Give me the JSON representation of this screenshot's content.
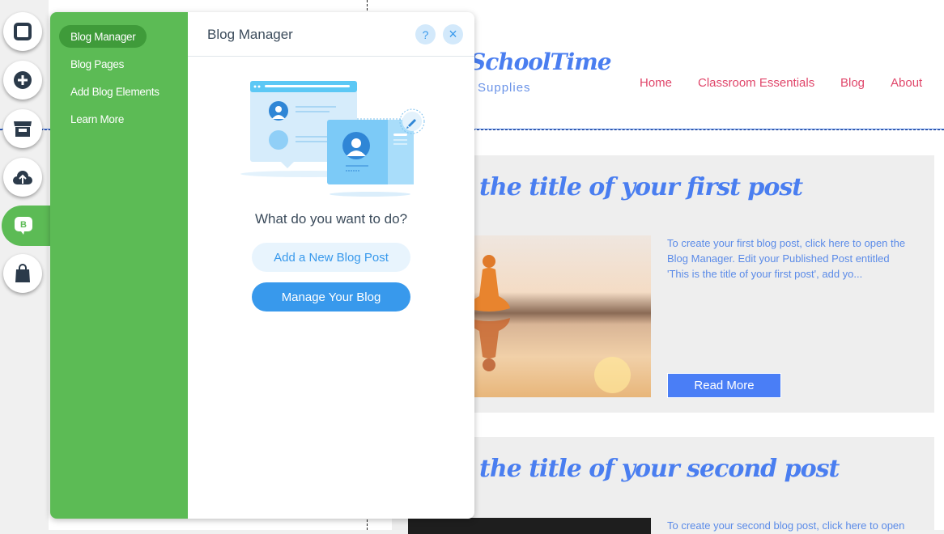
{
  "site": {
    "logo_title": "SchoolTime",
    "logo_subtitle": "Supplies",
    "nav": [
      "Home",
      "Classroom Essentials",
      "Blog",
      "About"
    ],
    "colors": {
      "accent_blue": "#4a7ef0",
      "nav_pink": "#e0466a"
    }
  },
  "posts": [
    {
      "title": "the title of your first post",
      "excerpt": "To create your first blog post, click here to open the Blog Manager.  Edit your Published Post entitled 'This is the title of your first post', add yo...",
      "read_more": "Read More"
    },
    {
      "title": "the title of your second post",
      "excerpt": "To create your second blog post, click here to open"
    }
  ],
  "toolbar": {
    "tools": [
      "background-icon",
      "add-icon",
      "store-icon",
      "upload-icon",
      "blog-icon",
      "shop-icon"
    ],
    "blog_badge": "B"
  },
  "panel": {
    "title": "Blog Manager",
    "help_label": "?",
    "close_label": "×",
    "nav": [
      {
        "label": "Blog Manager",
        "active": true
      },
      {
        "label": "Blog Pages",
        "active": false
      },
      {
        "label": "Add Blog Elements",
        "active": false
      },
      {
        "label": "Learn More",
        "active": false
      }
    ],
    "question": "What do you want to do?",
    "add_post_label": "Add a New Blog Post",
    "manage_blog_label": "Manage Your Blog",
    "colors": {
      "nav_green": "#5cbb55",
      "primary_blue": "#3899ec"
    }
  }
}
